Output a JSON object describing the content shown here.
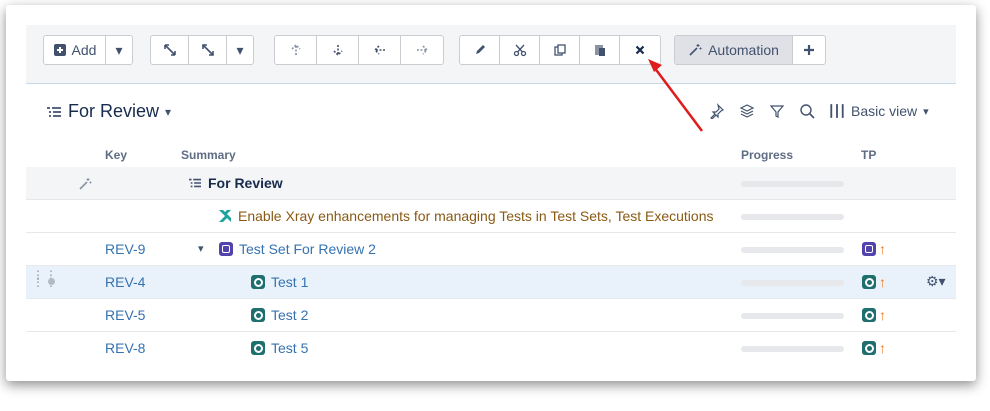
{
  "toolbar": {
    "add_label": "Add",
    "automation_label": "Automation"
  },
  "view": {
    "title": "For Review",
    "view_mode": "Basic view"
  },
  "columns": {
    "key": "Key",
    "summary": "Summary",
    "progress": "Progress",
    "tp": "TP"
  },
  "rows": [
    {
      "type": "group",
      "key": "",
      "summary": "For Review"
    },
    {
      "type": "issue",
      "key": "",
      "summary": "Enable Xray enhancements for managing Tests in Test Sets, Test Executions"
    },
    {
      "type": "set",
      "key": "REV-9",
      "summary": "Test Set For Review 2"
    },
    {
      "type": "test",
      "key": "REV-4",
      "summary": "Test 1"
    },
    {
      "type": "test",
      "key": "REV-5",
      "summary": "Test 2"
    },
    {
      "type": "test",
      "key": "REV-8",
      "summary": "Test 5"
    }
  ],
  "colors": {
    "accent": "#3572b0",
    "arrow": "#e01b1b",
    "priority": "#f07a1d"
  }
}
